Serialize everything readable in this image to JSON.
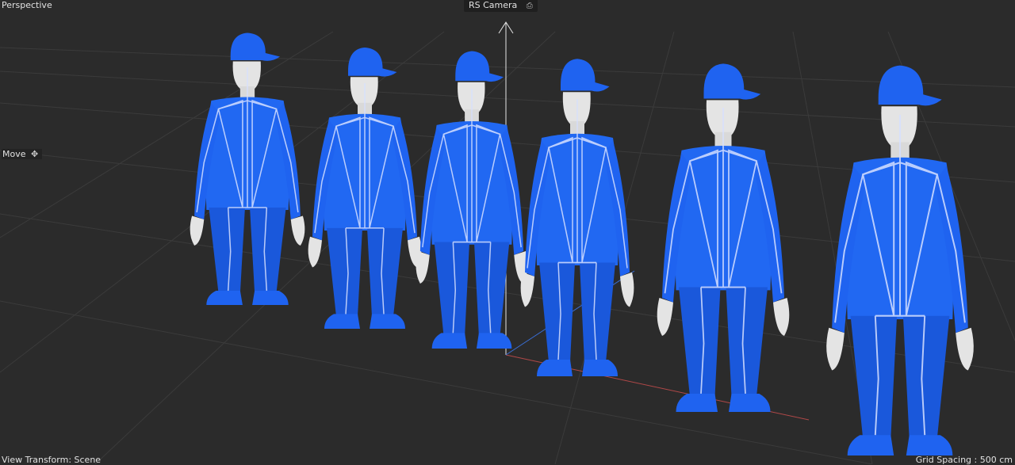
{
  "viewport": {
    "view_name": "Perspective",
    "camera_label": "RS Camera",
    "camera_icon": "camera-icon",
    "tool_label": "Move",
    "tool_icon": "move-arrows-icon",
    "view_transform": "View Transform: Scene",
    "grid_spacing": "Grid Spacing : 500 cm"
  },
  "scene": {
    "figure_count": 6,
    "figure_color": "#1f63f0",
    "skin_color": "#e6e6e6",
    "skeleton_color": "#cfd8ff",
    "x_axis_color": "#b04848",
    "y_axis_color": "#e6e6e6",
    "z_axis_color": "#3a6fd6"
  }
}
